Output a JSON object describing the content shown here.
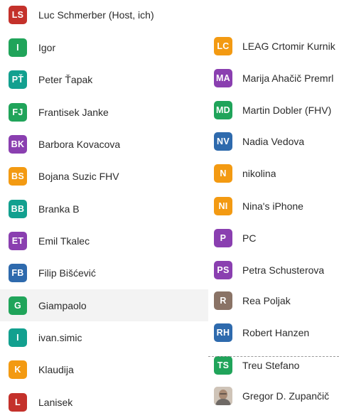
{
  "colors": {
    "red": "#c4312b",
    "green": "#20a45a",
    "teal": "#12a08f",
    "purple": "#8a3fb0",
    "orange": "#f39a12",
    "blue": "#2e6aad",
    "brown": "#8a7366"
  },
  "participants_left": [
    {
      "initials": "LS",
      "name": "Luc Schmerber (Host, ich)",
      "color": "#c4312b"
    },
    {
      "initials": "I",
      "name": "Igor",
      "color": "#20a45a"
    },
    {
      "initials": "PŤ",
      "name": "Peter Ťapak",
      "color": "#12a08f"
    },
    {
      "initials": "FJ",
      "name": "Frantisek Janke",
      "color": "#20a45a"
    },
    {
      "initials": "BK",
      "name": "Barbora Kovacova",
      "color": "#8a3fb0"
    },
    {
      "initials": "BS",
      "name": "Bojana Suzic FHV",
      "color": "#f39a12"
    },
    {
      "initials": "BB",
      "name": "Branka B",
      "color": "#12a08f"
    },
    {
      "initials": "ET",
      "name": "Emil Tkalec",
      "color": "#8a3fb0"
    },
    {
      "initials": "FB",
      "name": "Filip Bišćević",
      "color": "#2e6aad"
    },
    {
      "initials": "G",
      "name": "Giampaolo",
      "color": "#20a45a"
    },
    {
      "initials": "I",
      "name": "ivan.simic",
      "color": "#12a08f"
    },
    {
      "initials": "K",
      "name": "Klaudija",
      "color": "#f39a12"
    },
    {
      "initials": "L",
      "name": "Lanisek",
      "color": "#c4312b"
    }
  ],
  "participants_right": [
    {
      "initials": "LC",
      "name": "LEAG Crtomir Kurnik",
      "color": "#f39a12"
    },
    {
      "initials": "MA",
      "name": "Marija Ahačič Premrl",
      "color": "#8a3fb0"
    },
    {
      "initials": "MD",
      "name": "Martin Dobler (FHV)",
      "color": "#20a45a"
    },
    {
      "initials": "NV",
      "name": "Nadia Vedova",
      "color": "#2e6aad"
    },
    {
      "initials": "N",
      "name": "nikolina",
      "color": "#f39a12"
    },
    {
      "initials": "NI",
      "name": "Nina's iPhone",
      "color": "#f39a12"
    },
    {
      "initials": "P",
      "name": "PC",
      "color": "#8a3fb0"
    },
    {
      "initials": "PS",
      "name": "Petra Schusterova",
      "color": "#8a3fb0"
    },
    {
      "initials": "R",
      "name": "Rea Poljak",
      "color": "#8a7366"
    },
    {
      "initials": "RH",
      "name": "Robert Hanzen",
      "color": "#2e6aad"
    },
    {
      "initials": "TS",
      "name": "Treu Stefano",
      "color": "#20a45a"
    },
    {
      "initials": "",
      "name": "Gregor D. Zupančič",
      "color": "#d9cfc5",
      "photo": true
    }
  ]
}
